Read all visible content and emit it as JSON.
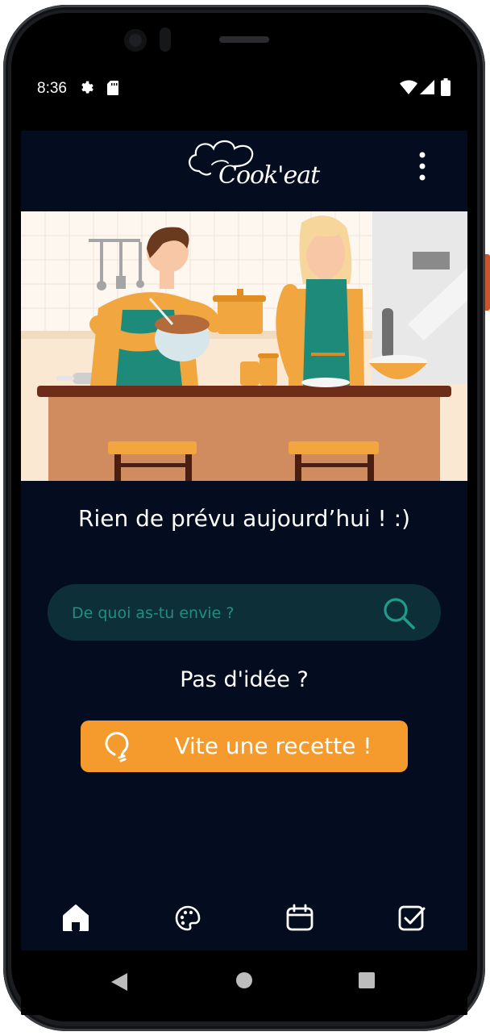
{
  "status_bar": {
    "time": "8:36",
    "left_icons": [
      "gear-icon",
      "sd-card-icon"
    ],
    "right_icons": [
      "wifi-icon",
      "signal-icon",
      "battery-icon"
    ]
  },
  "app_bar": {
    "logo_text": "Cook'eat",
    "menu_icon": "more-vertical-icon"
  },
  "main": {
    "empty_message": "Rien de prévu aujourd’hui ! :)",
    "search": {
      "placeholder": "De quoi as-tu envie ?",
      "value": "",
      "icon": "search-icon"
    },
    "idea_label": "Pas d'idée ?",
    "cta": {
      "label": "Vite une recette !",
      "icon": "lightbulb-icon"
    }
  },
  "bottom_nav": {
    "items": [
      {
        "icon": "home-icon",
        "active": true
      },
      {
        "icon": "palette-icon",
        "active": false
      },
      {
        "icon": "calendar-icon",
        "active": false
      },
      {
        "icon": "checkbox-icon",
        "active": false
      }
    ]
  },
  "system_nav": {
    "items": [
      "back-icon",
      "home-circle-icon",
      "recents-icon"
    ]
  },
  "colors": {
    "background": "#040c1f",
    "accent": "#f59a2d",
    "search_bg": "#0d3038",
    "search_accent": "#1f8f80",
    "text": "#ffffff"
  }
}
